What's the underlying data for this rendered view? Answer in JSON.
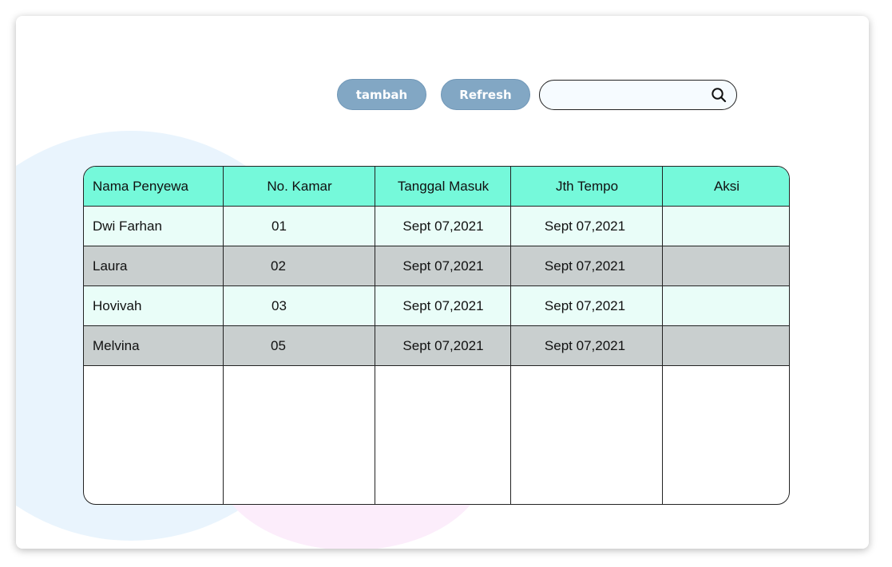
{
  "toolbar": {
    "add_label": "tambah",
    "refresh_label": "Refresh",
    "search_value": "",
    "search_icon": "search-icon"
  },
  "table": {
    "headers": [
      "Nama Penyewa",
      "No. Kamar",
      "Tanggal Masuk",
      "Jth Tempo",
      "Aksi"
    ],
    "rows": [
      {
        "nama": "Dwi Farhan",
        "kamar": "01",
        "masuk": "Sept 07,2021",
        "tempo": "Sept 07,2021",
        "aksi": ""
      },
      {
        "nama": "Laura",
        "kamar": "02",
        "masuk": "Sept 07,2021",
        "tempo": "Sept 07,2021",
        "aksi": ""
      },
      {
        "nama": "Hovivah",
        "kamar": "03",
        "masuk": "Sept 07,2021",
        "tempo": "Sept 07,2021",
        "aksi": ""
      },
      {
        "nama": "Melvina",
        "kamar": "05",
        "masuk": "Sept 07,2021",
        "tempo": "Sept 07,2021",
        "aksi": ""
      }
    ]
  },
  "colors": {
    "header_bg": "#75f9da",
    "row_light": "#e9fdf8",
    "row_dark": "#c9cfcf",
    "button_bg": "#82a7c4"
  }
}
